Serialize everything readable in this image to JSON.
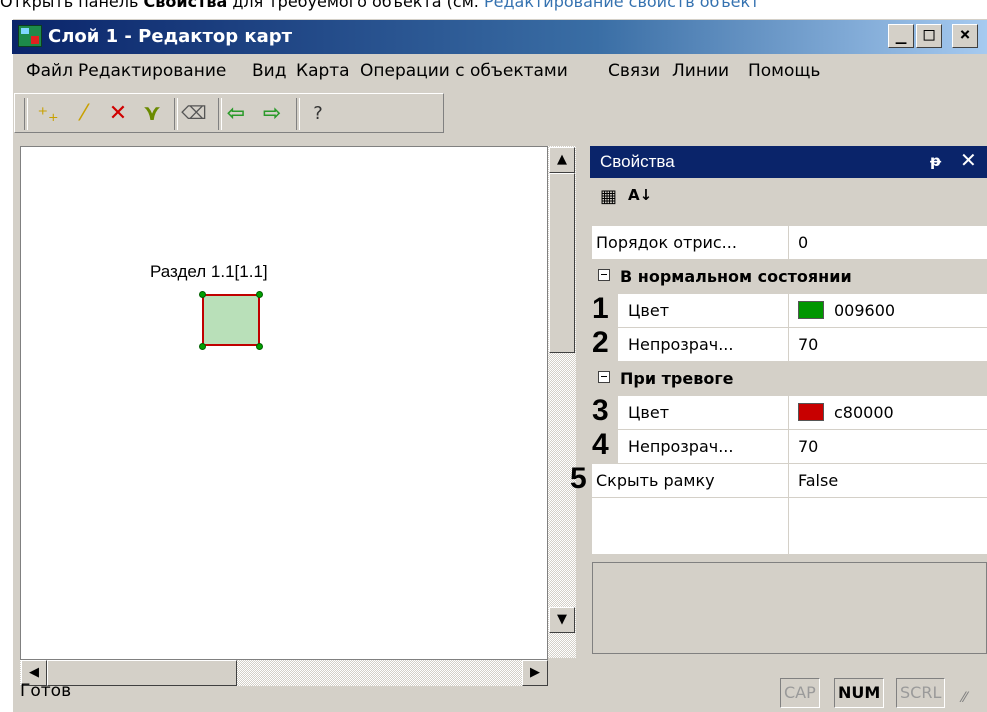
{
  "doc_header": {
    "prefix": "Открыть панель ",
    "bold": "Свойства",
    "middle": " для требуемого объекта (см. ",
    "link": "Редактирование свойств объект"
  },
  "window": {
    "title": "Слой 1 - Редактор карт",
    "controls": [
      "_",
      "□",
      "×"
    ]
  },
  "menu": [
    "Файл",
    "Редактирование",
    "Вид",
    "Карта",
    "Операции с объектами",
    "Связи",
    "Линии",
    "Помощь"
  ],
  "toolbar": [
    {
      "icon": "add-point-icon",
      "glyph": "⁺₊"
    },
    {
      "icon": "draw-line-icon",
      "glyph": "⁄"
    },
    {
      "icon": "delete-icon",
      "glyph": "✕"
    },
    {
      "icon": "edit-points-icon",
      "glyph": "⋎"
    },
    {
      "icon": "eraser-icon",
      "glyph": "⌫"
    },
    {
      "icon": "undo-icon",
      "glyph": "⇦"
    },
    {
      "icon": "redo-icon",
      "glyph": "⇨"
    },
    {
      "icon": "help-icon",
      "glyph": "?"
    }
  ],
  "canvas": {
    "shape_label": "Раздел 1.1[1.1]"
  },
  "properties": {
    "title": "Свойства",
    "pin": "ᵽ",
    "close": "✕",
    "rows": [
      {
        "name": "Порядок отрис...",
        "value": "0"
      },
      {
        "category": "В нормальном состоянии"
      },
      {
        "marker": "1",
        "name": "Цвет",
        "value": "009600",
        "color": "#009600"
      },
      {
        "marker": "2",
        "name": "Непрозрач...",
        "value": "70"
      },
      {
        "category": "При тревоге"
      },
      {
        "marker": "3",
        "name": "Цвет",
        "value": "c80000",
        "color": "#c80000"
      },
      {
        "marker": "4",
        "name": "Непрозрач...",
        "value": "70"
      },
      {
        "marker": "5",
        "name": "Скрыть рамку",
        "value": "False"
      }
    ]
  },
  "status": {
    "text": "Готов",
    "indicators": [
      {
        "label": "CAP",
        "on": false
      },
      {
        "label": "NUM",
        "on": true
      },
      {
        "label": "SCRL",
        "on": false
      }
    ]
  }
}
